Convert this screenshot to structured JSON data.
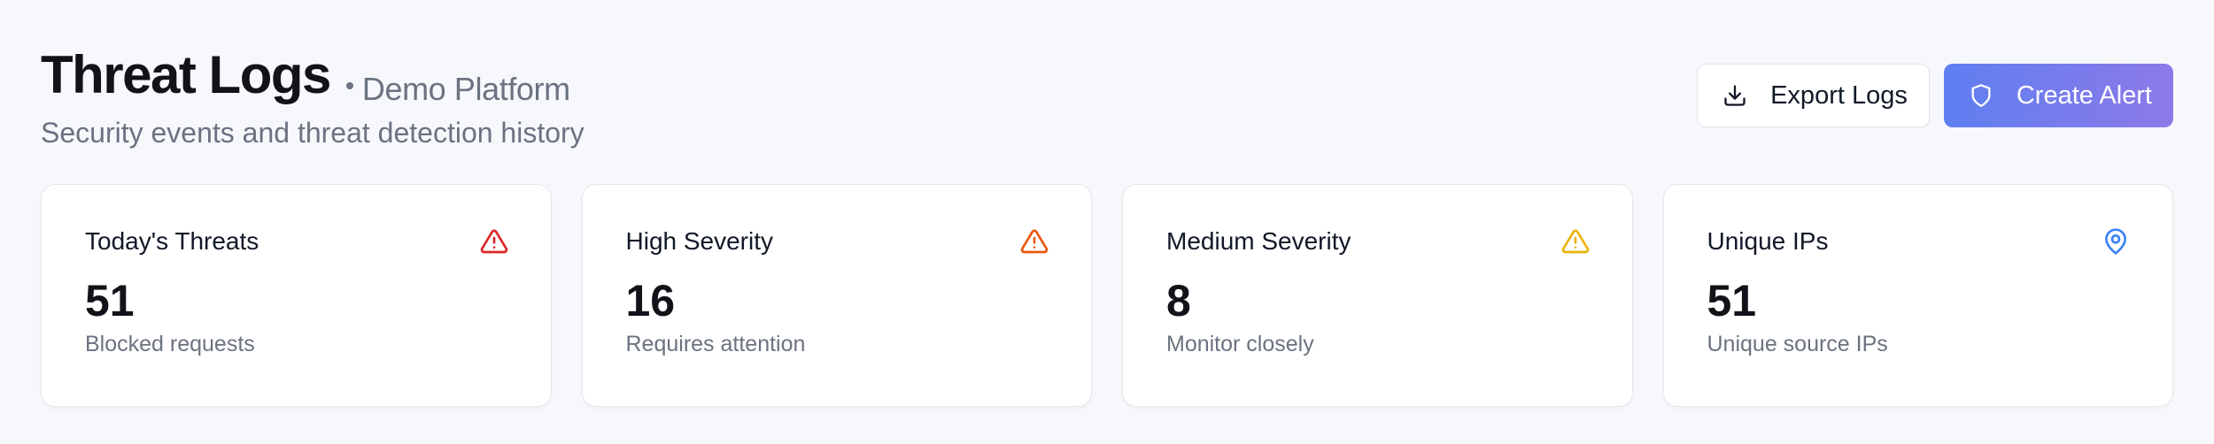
{
  "header": {
    "title": "Threat Logs",
    "platform": "Demo Platform",
    "subtitle": "Security events and threat detection history"
  },
  "actions": {
    "export_label": "Export Logs",
    "create_label": "Create Alert"
  },
  "cards": [
    {
      "title": "Today's Threats",
      "value": "51",
      "sub": "Blocked requests",
      "icon": "alert-triangle-icon",
      "icon_color": "#dc2626"
    },
    {
      "title": "High Severity",
      "value": "16",
      "sub": "Requires attention",
      "icon": "alert-triangle-icon",
      "icon_color": "#ea580c"
    },
    {
      "title": "Medium Severity",
      "value": "8",
      "sub": "Monitor closely",
      "icon": "alert-triangle-icon",
      "icon_color": "#eab308"
    },
    {
      "title": "Unique IPs",
      "value": "51",
      "sub": "Unique source IPs",
      "icon": "map-pin-icon",
      "icon_color": "#3b82f6"
    }
  ],
  "colors": {
    "accent_start": "#5f7ff0",
    "accent_end": "#8d79e8",
    "background": "#f6f8fc"
  }
}
